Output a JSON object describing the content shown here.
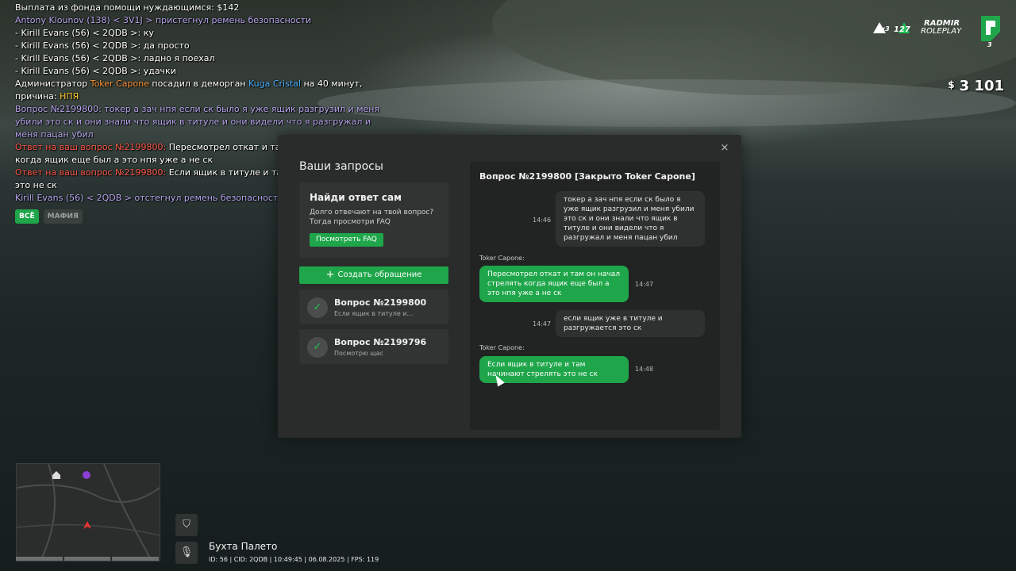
{
  "chat": {
    "lines": [
      {
        "parts": [
          {
            "t": "Выплата из фонда помощи нуждающимся: $142",
            "c": "white"
          }
        ]
      },
      {
        "parts": [
          {
            "t": "Antony Klounov (138) < 3V1J > пристегнул ремень безопасности",
            "c": "purple"
          }
        ]
      },
      {
        "parts": [
          {
            "t": "- Kirill Evans (56) < 2QDB >: ку",
            "c": "white"
          }
        ]
      },
      {
        "parts": [
          {
            "t": "- Kirill Evans (56) < 2QDB >: да просто",
            "c": "white"
          }
        ]
      },
      {
        "parts": [
          {
            "t": "- Kirill Evans (56) < 2QDB >: ладно я поехал",
            "c": "white"
          }
        ]
      },
      {
        "parts": [
          {
            "t": "- Kirill Evans (56) < 2QDB >: удачки",
            "c": "white"
          }
        ]
      },
      {
        "wrap": true,
        "parts": [
          {
            "t": "Администратор ",
            "c": "white"
          },
          {
            "t": "Toker Capone",
            "c": "orange"
          },
          {
            "t": " посадил в деморган ",
            "c": "white"
          },
          {
            "t": "Kuga Cristal",
            "c": "blue"
          },
          {
            "t": " на 40 минут, причина: ",
            "c": "white"
          },
          {
            "t": "НПЯ",
            "c": "yellow"
          }
        ]
      },
      {
        "wrap": true,
        "parts": [
          {
            "t": "Вопрос №2199800: токер а зач нпя если ск было я уже ящик разгрузил и меня убили это ск и они знали что ящик в титуле и они видели что я разгружал и меня пацан убил",
            "c": "purple"
          }
        ]
      },
      {
        "wrap": true,
        "parts": [
          {
            "t": "Ответ на ваш вопрос №2199800: ",
            "c": "red"
          },
          {
            "t": "Пересмотрел откат и там он начал стрелять когда ящик еще был а это нпя уже а не ск",
            "c": "white"
          }
        ]
      },
      {
        "wrap": true,
        "parts": [
          {
            "t": "Ответ на ваш вопрос №2199800: ",
            "c": "red"
          },
          {
            "t": "Если ящик в титуле и там начинают стрелять это не ск",
            "c": "white"
          }
        ]
      },
      {
        "parts": [
          {
            "t": "Kirill Evans (56) < 2QDB > отстегнул ремень безопасности",
            "c": "purple"
          }
        ]
      }
    ],
    "tabs": [
      {
        "label": "ВСЁ",
        "active": true
      },
      {
        "label": "МАФИЯ",
        "active": false
      }
    ]
  },
  "hud": {
    "badge_a": "x3",
    "badge_b": "127",
    "brand_line1": "RADMIR",
    "brand_line2": "ROLEPLAY",
    "server_num": "3",
    "money_symbol": "$",
    "money_value": "3 101"
  },
  "modal": {
    "title": "Ваши запросы",
    "close_glyph": "×",
    "faq": {
      "title": "Найди ответ сам",
      "text": "Долго отвечают на твой вопрос? Тогда просмотри FAQ",
      "button": "Посмотреть FAQ"
    },
    "create_button": "Создать обращение",
    "create_plus": "+",
    "requests": [
      {
        "title": "Вопрос №2199800",
        "subtitle": "Если ящик в титуле и...",
        "check": "✓"
      },
      {
        "title": "Вопрос №2199796",
        "subtitle": "Посмотрю щас",
        "check": "✓"
      }
    ],
    "conversation": {
      "header": "Вопрос №2199800 [Закрыто Toker Capone]",
      "messages": [
        {
          "from": "user",
          "text": "токер а зач нпя если ск было я уже ящик разгрузил и меня убили это ск и они знали что ящик в титуле и они видели что я разгружал и меня пацан убил",
          "time": "14:46"
        },
        {
          "from": "admin",
          "sender": "Toker Capone:",
          "text": "Пересмотрел откат и там он начал стрелять когда ящик еще был а это нпя уже а не ск",
          "time": "14:47"
        },
        {
          "from": "user",
          "text": "если ящик уже в титуле и разгружается это ск",
          "time": "14:47"
        },
        {
          "from": "admin",
          "sender": "Toker Capone:",
          "text": "Если ящик в титуле и там начинают стрелять это не ск",
          "time": "14:48"
        }
      ]
    }
  },
  "bottom": {
    "location": "Бухта Палето",
    "status": [
      "ID: 56",
      "CID: 2QDB",
      "10:49:45",
      "06.08.2025",
      "FPS: 119"
    ],
    "shield_icon": "⛉",
    "mic_icon": "🎙"
  },
  "colors": {
    "accent": "#1fa64a",
    "chat_purple": "#b9a6f0",
    "chat_red": "#ff5a4a",
    "chat_orange": "#ff9a3c",
    "chat_blue": "#4fb3ff",
    "chat_yellow": "#ffcc33"
  }
}
